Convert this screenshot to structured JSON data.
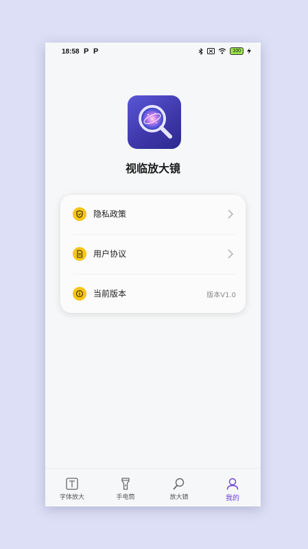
{
  "status_bar": {
    "time": "18:58",
    "notif_1": "P",
    "notif_2": "P",
    "battery": "100"
  },
  "app": {
    "name": "视临放大镜",
    "icon": "magnifier-galaxy-icon"
  },
  "menu": {
    "items": [
      {
        "label": "隐私政策",
        "icon": "shield-icon",
        "has_chevron": true
      },
      {
        "label": "用户协议",
        "icon": "document-icon",
        "has_chevron": true
      },
      {
        "label": "当前版本",
        "icon": "info-icon",
        "value": "版本V1.0"
      }
    ]
  },
  "tabbar": {
    "tabs": [
      {
        "label": "字体放大",
        "icon": "text-icon",
        "active": false
      },
      {
        "label": "手电筒",
        "icon": "flashlight-icon",
        "active": false
      },
      {
        "label": "放大镜",
        "icon": "magnifier-icon",
        "active": false
      },
      {
        "label": "我的",
        "icon": "person-icon",
        "active": true
      }
    ]
  },
  "colors": {
    "accent": "#6b3fd4",
    "icon_badge": "#f5c518",
    "background": "#f6f7f8"
  }
}
